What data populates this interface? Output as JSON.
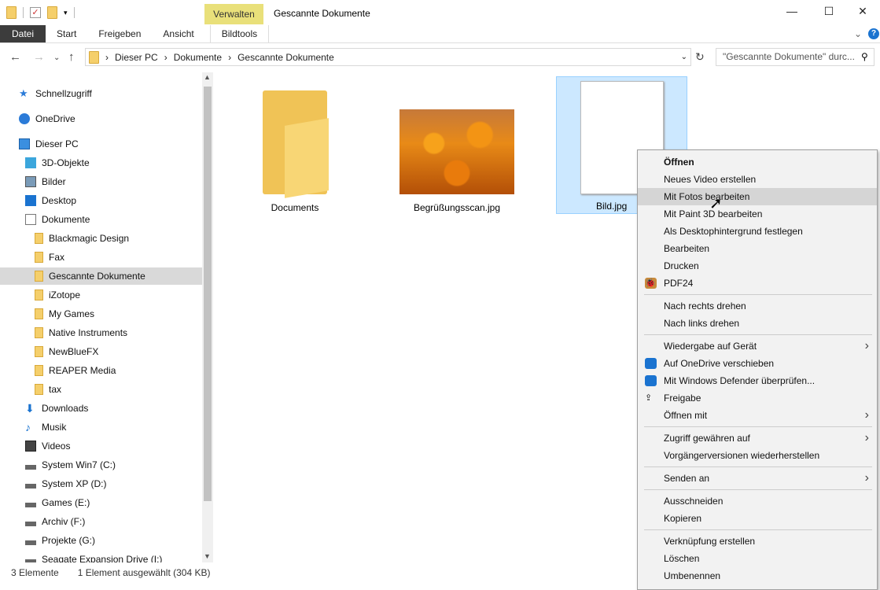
{
  "window": {
    "title": "Gescannte Dokumente",
    "context_tab": "Verwalten",
    "minimize": "—",
    "maximize": "☐",
    "close": "✕"
  },
  "ribbon": {
    "tabs": [
      "Datei",
      "Start",
      "Freigeben",
      "Ansicht",
      "Bildtools"
    ]
  },
  "address": {
    "crumbs": [
      "Dieser PC",
      "Dokumente",
      "Gescannte Dokumente"
    ],
    "search_placeholder": "\"Gescannte Dokumente\" durc..."
  },
  "sidebar": {
    "items": [
      {
        "label": "Schnellzugriff",
        "icon": "star-icon",
        "level": 0
      },
      {
        "label": "OneDrive",
        "icon": "cloud-icon",
        "level": 0
      },
      {
        "label": "Dieser PC",
        "icon": "computer-icon",
        "level": 0
      },
      {
        "label": "3D-Objekte",
        "icon": "cube-icon",
        "level": 1
      },
      {
        "label": "Bilder",
        "icon": "pictures-icon",
        "level": 1
      },
      {
        "label": "Desktop",
        "icon": "desktop-icon",
        "level": 1
      },
      {
        "label": "Dokumente",
        "icon": "document-icon",
        "level": 1
      },
      {
        "label": "Blackmagic Design",
        "icon": "folder-icon",
        "level": 2
      },
      {
        "label": "Fax",
        "icon": "folder-icon",
        "level": 2
      },
      {
        "label": "Gescannte Dokumente",
        "icon": "folder-icon",
        "level": 2,
        "selected": true
      },
      {
        "label": "iZotope",
        "icon": "folder-icon",
        "level": 2
      },
      {
        "label": "My Games",
        "icon": "folder-icon",
        "level": 2
      },
      {
        "label": "Native Instruments",
        "icon": "folder-icon",
        "level": 2
      },
      {
        "label": "NewBlueFX",
        "icon": "folder-icon",
        "level": 2
      },
      {
        "label": "REAPER Media",
        "icon": "folder-icon",
        "level": 2
      },
      {
        "label": "tax",
        "icon": "folder-icon",
        "level": 2
      },
      {
        "label": "Downloads",
        "icon": "download-icon",
        "level": 1
      },
      {
        "label": "Musik",
        "icon": "music-icon",
        "level": 1
      },
      {
        "label": "Videos",
        "icon": "video-icon",
        "level": 1
      },
      {
        "label": "System Win7 (C:)",
        "icon": "drive-icon",
        "level": 1
      },
      {
        "label": "System XP (D:)",
        "icon": "drive-icon",
        "level": 1
      },
      {
        "label": "Games (E:)",
        "icon": "drive-icon",
        "level": 1
      },
      {
        "label": "Archiv (F:)",
        "icon": "drive-icon",
        "level": 1
      },
      {
        "label": "Projekte (G:)",
        "icon": "drive-icon",
        "level": 1
      },
      {
        "label": "Seagate Expansion Drive (I:)",
        "icon": "drive-icon",
        "level": 1
      }
    ]
  },
  "files": [
    {
      "name": "Documents"
    },
    {
      "name": "Begrüßungsscan.jpg"
    },
    {
      "name": "Bild.jpg",
      "selected": true
    }
  ],
  "context_menu": [
    {
      "label": "Öffnen",
      "bold": true
    },
    {
      "label": "Neues Video erstellen"
    },
    {
      "label": "Mit Fotos bearbeiten",
      "highlighted": true
    },
    {
      "label": "Mit Paint 3D bearbeiten"
    },
    {
      "label": "Als Desktophintergrund festlegen"
    },
    {
      "label": "Bearbeiten"
    },
    {
      "label": "Drucken"
    },
    {
      "label": "PDF24",
      "icon": "pdf24-icon"
    },
    {
      "sep": true
    },
    {
      "label": "Nach rechts drehen"
    },
    {
      "label": "Nach links drehen"
    },
    {
      "sep": true
    },
    {
      "label": "Wiedergabe auf Gerät",
      "submenu": true
    },
    {
      "label": "Auf OneDrive verschieben",
      "icon": "onedrive-icon"
    },
    {
      "label": "Mit Windows Defender überprüfen...",
      "icon": "defender-icon"
    },
    {
      "label": "Freigabe",
      "icon": "share-icon"
    },
    {
      "label": "Öffnen mit",
      "submenu": true
    },
    {
      "sep": true
    },
    {
      "label": "Zugriff gewähren auf",
      "submenu": true
    },
    {
      "label": "Vorgängerversionen wiederherstellen"
    },
    {
      "sep": true
    },
    {
      "label": "Senden an",
      "submenu": true
    },
    {
      "sep": true
    },
    {
      "label": "Ausschneiden"
    },
    {
      "label": "Kopieren"
    },
    {
      "sep": true
    },
    {
      "label": "Verknüpfung erstellen"
    },
    {
      "label": "Löschen"
    },
    {
      "label": "Umbenennen"
    }
  ],
  "status": {
    "count": "3 Elemente",
    "selection": "1 Element ausgewählt (304 KB)"
  },
  "colors": {
    "accent": "#0078d7",
    "selection": "#cce8ff",
    "context_tab": "#e9e07a"
  }
}
